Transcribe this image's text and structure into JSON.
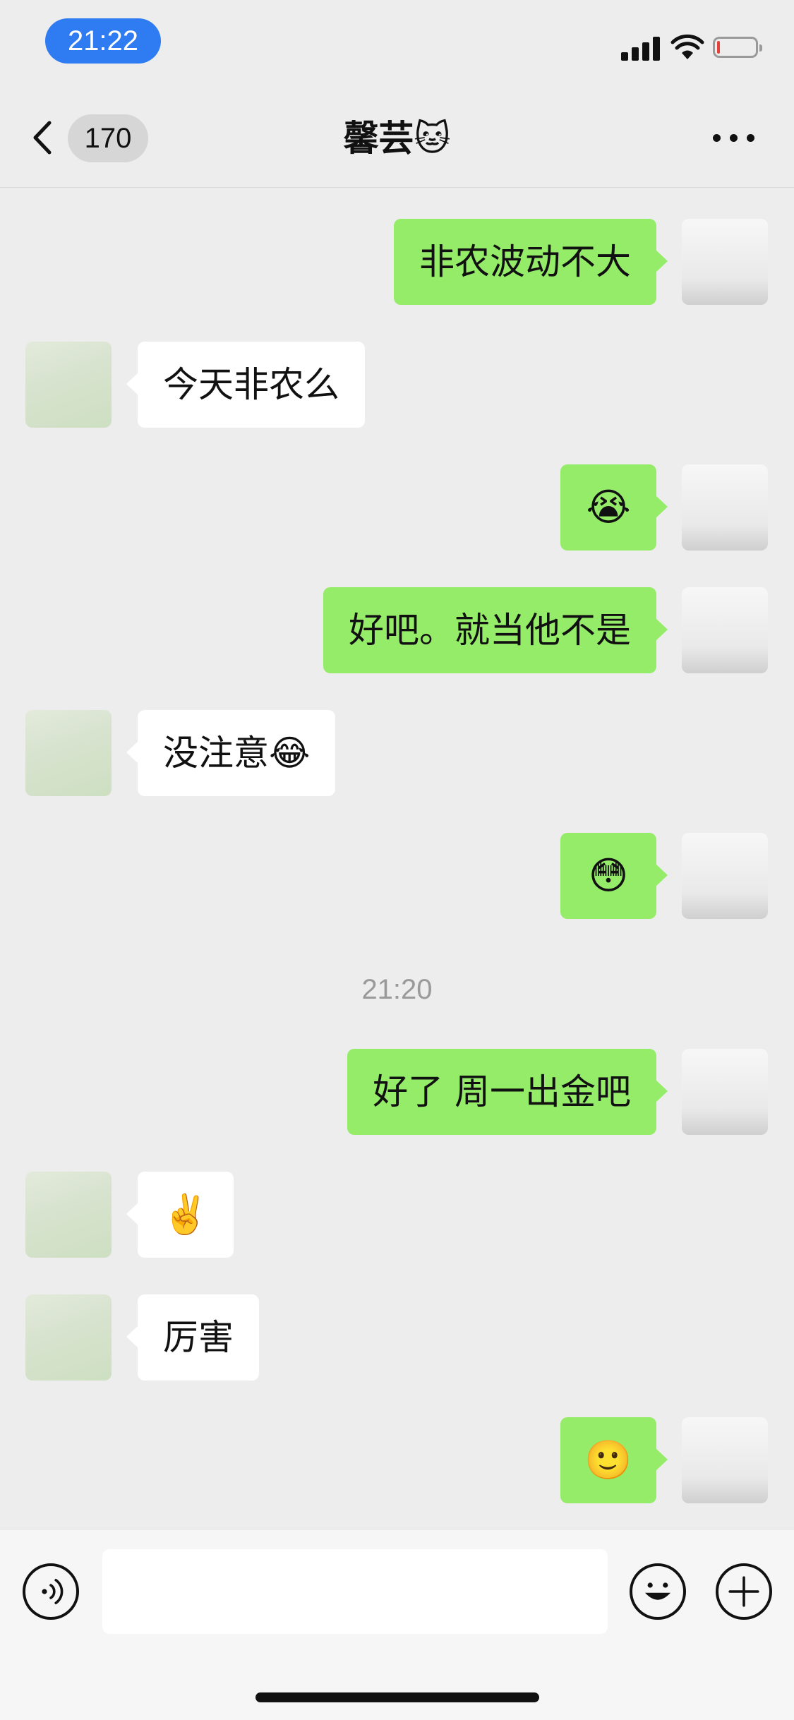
{
  "status_bar": {
    "time": "21:22",
    "battery_level": 0.08
  },
  "nav": {
    "unread_count": "170",
    "title": "馨芸🐱"
  },
  "messages": [
    {
      "sender": "self",
      "text": "非农波动不大"
    },
    {
      "sender": "peer",
      "text": "今天非农么"
    },
    {
      "sender": "self",
      "text": "😭"
    },
    {
      "sender": "self",
      "text": "好吧。就当他不是"
    },
    {
      "sender": "peer",
      "text": "没注意😂"
    },
    {
      "sender": "self",
      "text": "😳"
    },
    {
      "sender": "self",
      "text": "好了 周一出金吧"
    },
    {
      "sender": "peer",
      "text": "✌️"
    },
    {
      "sender": "peer",
      "text": "厉害"
    },
    {
      "sender": "self",
      "text": "🙂"
    }
  ],
  "time_separator": "21:20",
  "input": {
    "value": "",
    "placeholder": ""
  },
  "icons": {
    "back": "chevron-left-icon",
    "more": "more-dots-icon",
    "voice": "voice-icon",
    "emoji": "emoji-icon",
    "plus": "plus-icon"
  },
  "colors": {
    "self_bubble": "#95ec69",
    "peer_bubble": "#ffffff",
    "time_pill": "#2f7bf2",
    "battery_low": "#e5413a"
  }
}
